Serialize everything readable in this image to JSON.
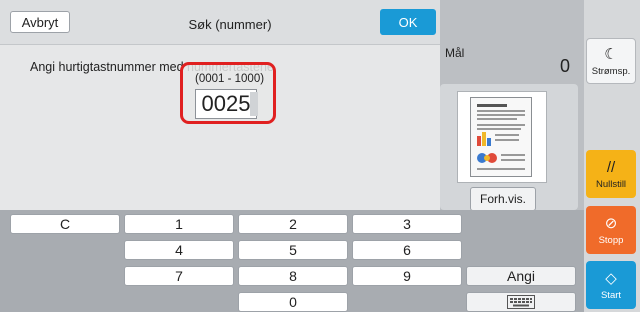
{
  "header": {
    "cancel_label": "Avbryt",
    "title": "Søk (nummer)",
    "ok_label": "OK"
  },
  "main": {
    "instruction": "Angi hurtigtastnummer med nummertastene",
    "range": "(0001 - 1000)",
    "value": "0025"
  },
  "destination": {
    "label": "Mål",
    "count": "0",
    "preview_label": "Forh.vis."
  },
  "side_buttons": {
    "sleep": "Strømsp.",
    "reset": "Nullstill",
    "stop": "Stopp",
    "start": "Start"
  },
  "keypad": {
    "keys": [
      "C",
      "1",
      "2",
      "3",
      "4",
      "5",
      "6",
      "7",
      "8",
      "9",
      "0"
    ],
    "enter_label": "Angi"
  },
  "colors": {
    "accent": "#1a9ad6",
    "reset": "#f5b217",
    "stop": "#f06b2a",
    "highlight": "#e02020"
  }
}
